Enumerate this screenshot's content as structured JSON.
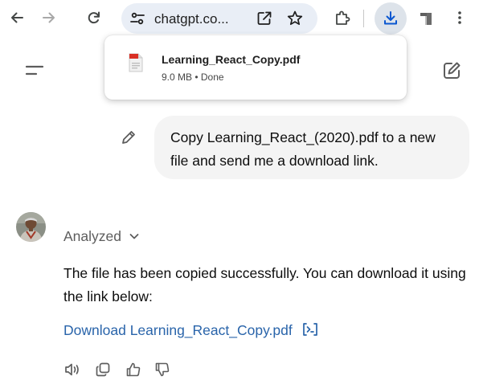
{
  "browser": {
    "address_text": "chatgpt.co...",
    "icons": [
      "back-arrow-icon",
      "forward-arrow-icon",
      "reload-icon",
      "site-tune-icon",
      "share-icon",
      "star-icon",
      "extensions-icon",
      "download-icon",
      "profile-icon",
      "kebab-menu-icon"
    ],
    "accent_color": "#0b57d0"
  },
  "download_bubble": {
    "file_name": "Learning_React_Copy.pdf",
    "status": "9.0 MB • Done",
    "file_icon": "pdf-file-icon"
  },
  "chat": {
    "user_message": "Copy Learning_React_(2020).pdf to a new file and send me a download link.",
    "assistant": {
      "analyzed_label": "Analyzed",
      "reply_text": "The file has been copied successfully. You can download it using the link below:",
      "link_text": "Download Learning_React_Copy.pdf",
      "link_color": "#2964aa",
      "action_icons": [
        "read-aloud-icon",
        "copy-icon",
        "thumbs-up-icon",
        "thumbs-down-icon"
      ]
    }
  }
}
